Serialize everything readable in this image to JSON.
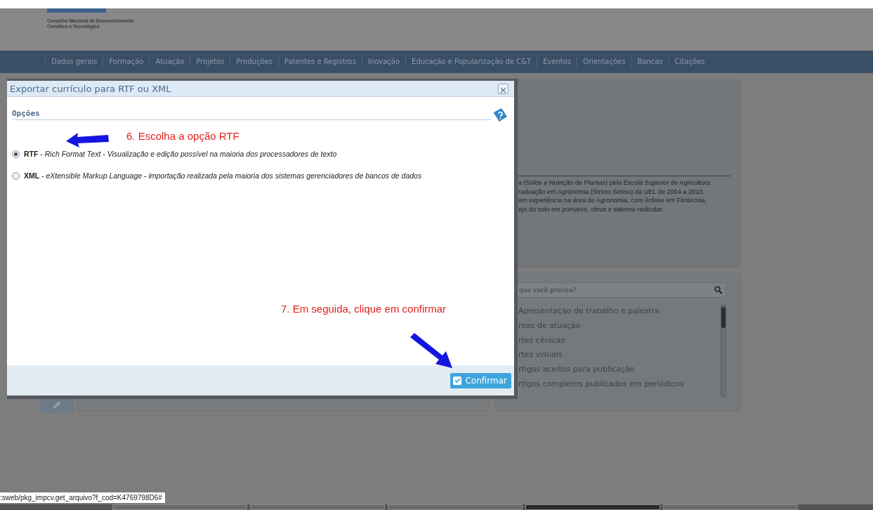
{
  "header": {
    "org_lines": [
      "Conselho Nacional de Desenvolvimento",
      "Científico e Tecnológico"
    ]
  },
  "nav": {
    "items": [
      "Dados gerais",
      "Formação",
      "Atuação",
      "Projetos",
      "Produções",
      "Patentes e Registros",
      "Inovação",
      "Educação e Popularização de C&T",
      "Eventos",
      "Orientações",
      "Bancas",
      "Citações"
    ]
  },
  "summary": {
    "lines": [
      "a (Solos e Nutrição de Plantas) pela Escola Superior de Agricultura",
      "raduação em Agronomia (Stricto Sensu) da UEL de 2004 a 2010.",
      "em experiência na área de Agronomia, com ênfase em Fitotecnia,",
      "ejo do solo em pomares, citrus e sistema radicular."
    ]
  },
  "search": {
    "placeholder": "que você precisa?"
  },
  "topics": {
    "items": [
      "Apresentação de trabalho e palestra",
      "reas de atuação",
      "rtes cênicas",
      "rtes visuais",
      "rtigos aceitos para publicação",
      "rtigos completos publicados em periódicos"
    ]
  },
  "dialog": {
    "title": "Exportar currículo para RTF ou XML",
    "section": "Opções",
    "options": [
      {
        "text": "**RTF** - *Rich Format Text - Visualização e edição possível na maioria dos processadores de texto*",
        "selected": true
      },
      {
        "text": "**XML** - *eXtensible Markup Language - importação realizada pela maioria dos sistemas gerenciadores de bancos de dados*",
        "selected": false
      }
    ],
    "confirm": "Confirmar"
  },
  "annotations": [
    "6. Escolha a opção RTF",
    "7. Em seguida, clique em confirmar"
  ],
  "status_bar": {
    "url": ":sweb/pkg_impcv.get_arquivo?f_cod=K4769798D6#"
  }
}
